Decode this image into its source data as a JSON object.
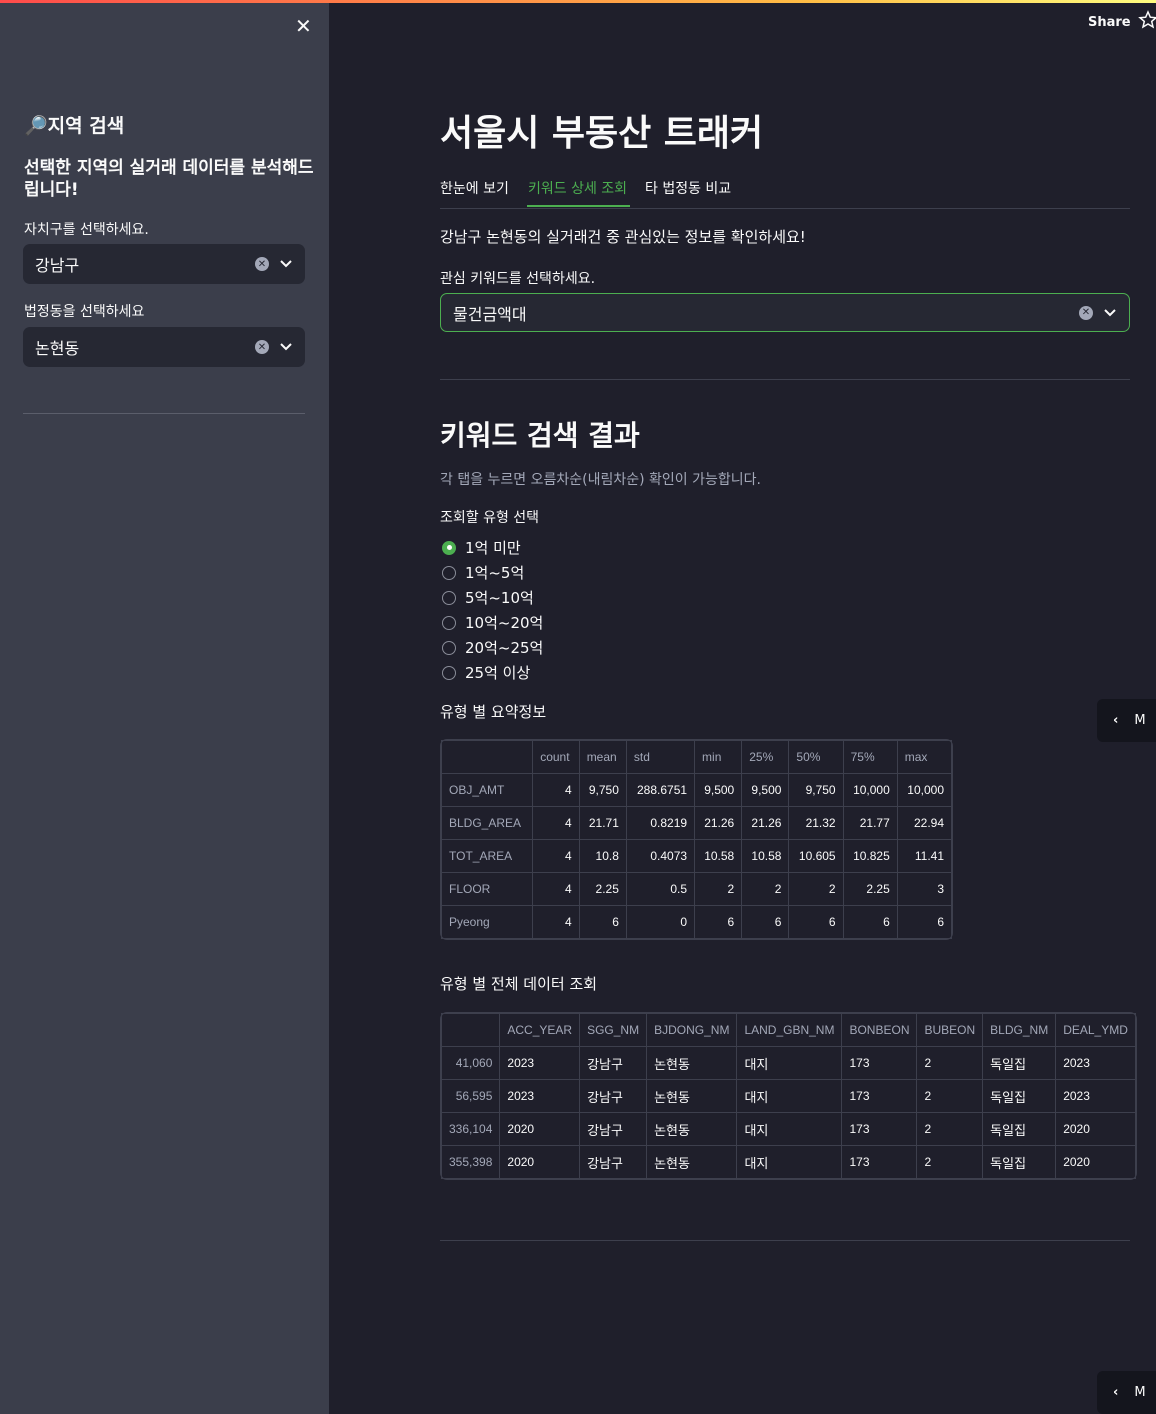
{
  "sidebar": {
    "title": "🔎지역 검색",
    "subtitle": "선택한 지역의 실거래 데이터를 분석해드립니다!",
    "district_label": "자치구를 선택하세요.",
    "district_value": "강남구",
    "dong_label": "법정동을 선택하세요",
    "dong_value": "논현동"
  },
  "header": {
    "share": "Share"
  },
  "main": {
    "title": "서울시 부동산 트래커",
    "tabs": [
      {
        "label": "한눈에 보기"
      },
      {
        "label": "키워드 상세 조회"
      },
      {
        "label": "타 법정동 비교"
      }
    ],
    "intro": "강남구 논현동의 실거래건 중 관심있는 정보를 확인하세요!",
    "keyword_label": "관심 키워드를 선택하세요.",
    "keyword_value": "물건금액대",
    "result_title": "키워드 검색 결과",
    "result_caption": "각 탭을 누르면 오름차순(내림차순) 확인이 가능합니다.",
    "radio_label": "조회할 유형 선택",
    "radio_options": [
      "1억 미만",
      "1억~5억",
      "5억~10억",
      "10억~20억",
      "20억~25억",
      "25억 이상"
    ],
    "radio_selected": "1억 미만",
    "summary_label": "유형 별 요약정보",
    "full_label": "유형 별 전체 데이터 조회",
    "side_button": "M"
  },
  "summary_table": {
    "columns": [
      "",
      "count",
      "mean",
      "std",
      "min",
      "25%",
      "50%",
      "75%",
      "max"
    ],
    "rows": [
      [
        "OBJ_AMT",
        "4",
        "9,750",
        "288.6751",
        "9,500",
        "9,500",
        "9,750",
        "10,000",
        "10,000"
      ],
      [
        "BLDG_AREA",
        "4",
        "21.71",
        "0.8219",
        "21.26",
        "21.26",
        "21.32",
        "21.77",
        "22.94"
      ],
      [
        "TOT_AREA",
        "4",
        "10.8",
        "0.4073",
        "10.58",
        "10.58",
        "10.605",
        "10.825",
        "11.41"
      ],
      [
        "FLOOR",
        "4",
        "2.25",
        "0.5",
        "2",
        "2",
        "2",
        "2.25",
        "3"
      ],
      [
        "Pyeong",
        "4",
        "6",
        "0",
        "6",
        "6",
        "6",
        "6",
        "6"
      ]
    ]
  },
  "full_table": {
    "columns": [
      "",
      "ACC_YEAR",
      "SGG_NM",
      "BJDONG_NM",
      "LAND_GBN_NM",
      "BONBEON",
      "BUBEON",
      "BLDG_NM",
      "DEAL_YMD"
    ],
    "rows": [
      [
        "41,060",
        "2023",
        "강남구",
        "논현동",
        "대지",
        "173",
        "2",
        "독일집",
        "2023"
      ],
      [
        "56,595",
        "2023",
        "강남구",
        "논현동",
        "대지",
        "173",
        "2",
        "독일집",
        "2023"
      ],
      [
        "336,104",
        "2020",
        "강남구",
        "논현동",
        "대지",
        "173",
        "2",
        "독일집",
        "2020"
      ],
      [
        "355,398",
        "2020",
        "강남구",
        "논현동",
        "대지",
        "173",
        "2",
        "독일집",
        "2020"
      ]
    ]
  }
}
